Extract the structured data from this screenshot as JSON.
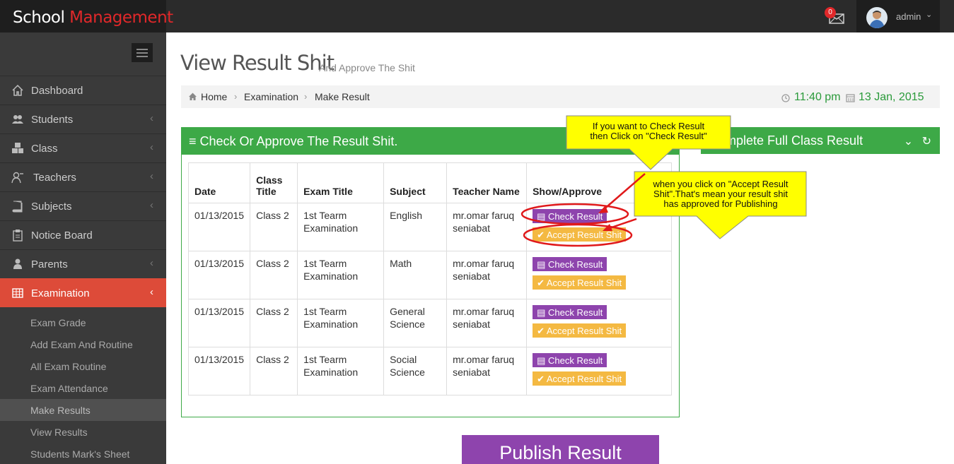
{
  "app": {
    "brand_part1": "School ",
    "brand_part2": "Management",
    "brand_accent": "#e0282a"
  },
  "header": {
    "mail_count": "0",
    "user_name": "admin"
  },
  "sidebar": {
    "items": [
      {
        "label": "Dashboard",
        "icon": "home-icon"
      },
      {
        "label": "Students",
        "icon": "users-icon"
      },
      {
        "label": "Class",
        "icon": "cubes-icon"
      },
      {
        "label": "Teachers",
        "icon": "teacher-icon"
      },
      {
        "label": "Subjects",
        "icon": "book-icon"
      },
      {
        "label": "Notice Board",
        "icon": "clipboard-icon"
      },
      {
        "label": "Parents",
        "icon": "user-icon"
      },
      {
        "label": "Examination",
        "icon": "table-icon"
      }
    ],
    "submenu": [
      "Exam Grade",
      "Add Exam And Routine",
      "All Exam Routine",
      "Exam Attendance",
      "Make Results",
      "View Results",
      "Students Mark's Sheet"
    ]
  },
  "page": {
    "title": "View Result Shit",
    "subtitle": "And Approve The Shit"
  },
  "breadcrumb": {
    "items": [
      "Home",
      "Examination",
      "Make Result"
    ],
    "time": "11:40 pm",
    "date": "13 Jan, 2015"
  },
  "panel_left": {
    "title": "Check Or Approve The Result Shit."
  },
  "panel_right": {
    "title": "Complete Full Class Result"
  },
  "table": {
    "headers": [
      "Date",
      "Class Title",
      "Exam Title",
      "Subject",
      "Teacher Name",
      "Show/Approve"
    ],
    "rows": [
      {
        "date": "01/13/2015",
        "class": "Class 2",
        "exam": "1st Tearm Examination",
        "subject": "English",
        "teacher": "mr.omar faruq seniabat"
      },
      {
        "date": "01/13/2015",
        "class": "Class 2",
        "exam": "1st Tearm Examination",
        "subject": "Math",
        "teacher": "mr.omar faruq seniabat"
      },
      {
        "date": "01/13/2015",
        "class": "Class 2",
        "exam": "1st Tearm Examination",
        "subject": "General Science",
        "teacher": "mr.omar faruq seniabat"
      },
      {
        "date": "01/13/2015",
        "class": "Class 2",
        "exam": "1st Tearm Examination",
        "subject": "Social Science",
        "teacher": "mr.omar faruq seniabat"
      }
    ],
    "check_label": "Check Result",
    "accept_label": "Accept Result Shit"
  },
  "publish_label": "Publish Result",
  "annotations": {
    "note1_line1": "If you want to Check Result",
    "note1_line2": "then Click on \"Check Result\"",
    "note2_line1": "when you click on \"Accept Result",
    "note2_line2": "Shit\".That's mean your result shit",
    "note2_line3": "has approved for Publishing"
  },
  "colors": {
    "sidebar_bg": "#3a3a3a",
    "active_menu": "#dd4b39",
    "panel_green": "#3da947",
    "check_purple": "#8e44ad",
    "accept_orange": "#f4b942",
    "date_green": "#2a9a3a",
    "callout_yellow": "#ffff00"
  }
}
